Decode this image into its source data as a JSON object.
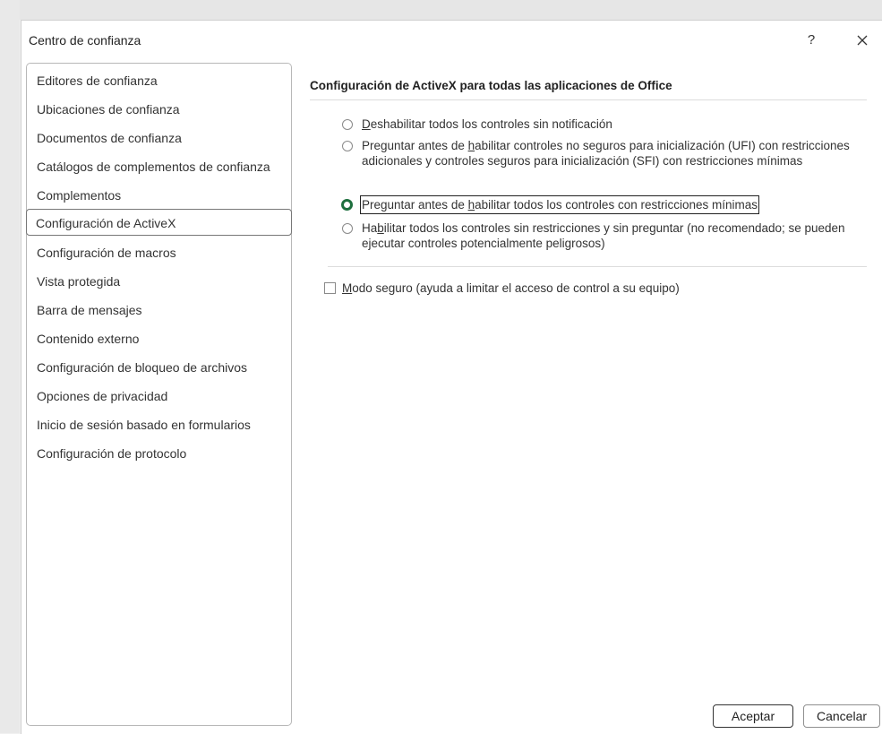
{
  "dialog": {
    "title": "Centro de confianza",
    "help_label": "?",
    "close_icon": "close-icon"
  },
  "nav": {
    "selected_index": 5,
    "items": [
      {
        "label": "Editores de confianza"
      },
      {
        "label": "Ubicaciones de confianza"
      },
      {
        "label": "Documentos de confianza"
      },
      {
        "label": "Catálogos de complementos de confianza"
      },
      {
        "label": "Complementos"
      },
      {
        "label": "Configuración de ActiveX"
      },
      {
        "label": "Configuración de macros"
      },
      {
        "label": "Vista protegida"
      },
      {
        "label": "Barra de mensajes"
      },
      {
        "label": "Contenido externo"
      },
      {
        "label": "Configuración de bloqueo de archivos"
      },
      {
        "label": "Opciones de privacidad"
      },
      {
        "label": "Inicio de sesión basado en formularios"
      },
      {
        "label": "Configuración de protocolo"
      }
    ]
  },
  "activex": {
    "section_title": "Configuración de ActiveX para todas las aplicaciones de Office",
    "selected_option": 2,
    "options": [
      {
        "pre": "",
        "accel": "D",
        "post": "eshabilitar todos los controles sin notificación"
      },
      {
        "pre": "Preguntar antes de ",
        "accel": "h",
        "post": "abilitar controles no seguros para inicialización (UFI) con restricciones adicionales y controles seguros para inicialización (SFI) con restricciones mínimas"
      },
      {
        "pre": "Preguntar antes de ",
        "accel": "h",
        "post": "abilitar todos los controles con restricciones mínimas"
      },
      {
        "pre": "Ha",
        "accel": "b",
        "post": "ilitar todos los controles sin restricciones y sin preguntar (no recomendado; se pueden ejecutar controles potencialmente peligrosos)"
      }
    ],
    "safe_mode": {
      "accel": "M",
      "post": "odo seguro (ayuda a limitar el acceso de control a su equipo)",
      "checked": false
    }
  },
  "buttons": {
    "ok_label": "Aceptar",
    "cancel_label": "Cancelar"
  }
}
